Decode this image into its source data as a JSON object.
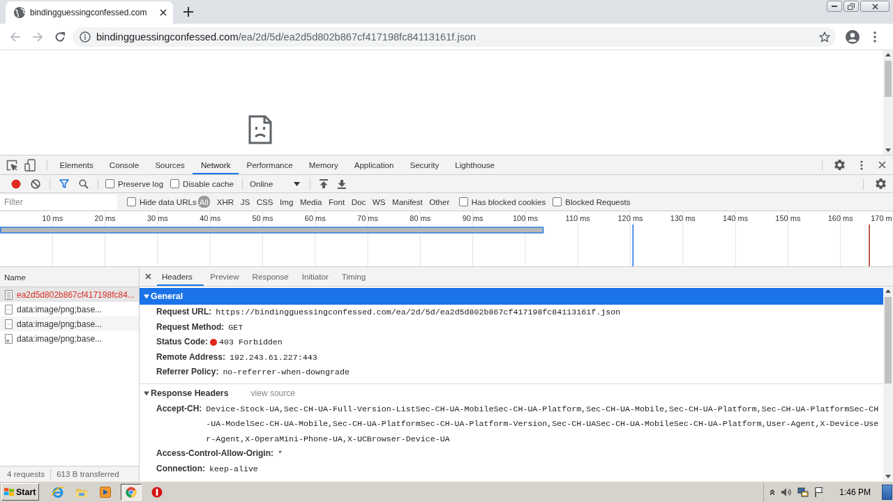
{
  "browser": {
    "tab": {
      "title": "bindingguessingconfessed.com"
    },
    "nav": [
      {
        "kind": "back",
        "disabled": true
      },
      {
        "kind": "forward",
        "disabled": true
      },
      {
        "kind": "reload",
        "disabled": false
      }
    ],
    "address": {
      "domain": "bindingguessingconfessed.com",
      "path": "/ea/2d/5d/ea2d5d802b867cf417198fc84113161f.json"
    }
  },
  "devtools": {
    "panels": [
      {
        "label": "Elements",
        "selected": false
      },
      {
        "label": "Console",
        "selected": false
      },
      {
        "label": "Sources",
        "selected": false
      },
      {
        "label": "Network",
        "selected": true
      },
      {
        "label": "Performance",
        "selected": false
      },
      {
        "label": "Memory",
        "selected": false
      },
      {
        "label": "Application",
        "selected": false
      },
      {
        "label": "Security",
        "selected": false
      },
      {
        "label": "Lighthouse",
        "selected": false
      }
    ],
    "toolbar": {
      "recording": true,
      "filter_active": true,
      "options": [
        {
          "label": "Preserve log",
          "checked": false
        },
        {
          "label": "Disable cache",
          "checked": false
        }
      ],
      "throttling": "Online"
    },
    "filter": {
      "placeholder": "Filter",
      "hide_data_urls": {
        "label": "Hide data URLs",
        "checked": false
      },
      "types": [
        {
          "label": "All",
          "selected": true
        },
        {
          "label": "XHR",
          "selected": false
        },
        {
          "label": "JS",
          "selected": false
        },
        {
          "label": "CSS",
          "selected": false
        },
        {
          "label": "Img",
          "selected": false
        },
        {
          "label": "Media",
          "selected": false
        },
        {
          "label": "Font",
          "selected": false
        },
        {
          "label": "Doc",
          "selected": false
        },
        {
          "label": "WS",
          "selected": false
        },
        {
          "label": "Manifest",
          "selected": false
        },
        {
          "label": "Other",
          "selected": false
        }
      ],
      "options": [
        {
          "label": "Has blocked cookies",
          "checked": false
        },
        {
          "label": "Blocked Requests",
          "checked": false
        }
      ]
    },
    "overview": {
      "chart_data": {
        "type": "bar",
        "orientation": "horizontal",
        "values": [
          103.5
        ],
        "xlim": [
          0,
          170
        ],
        "grid": true,
        "xticks": [
          {
            "value": 10,
            "label": "10 ms"
          },
          {
            "value": 20,
            "label": "20 ms"
          },
          {
            "value": 30,
            "label": "30 ms"
          },
          {
            "value": 40,
            "label": "40 ms"
          },
          {
            "value": 50,
            "label": "50 ms"
          },
          {
            "value": 60,
            "label": "60 ms"
          },
          {
            "value": 70,
            "label": "70 ms"
          },
          {
            "value": 80,
            "label": "80 ms"
          },
          {
            "value": 90,
            "label": "90 ms"
          },
          {
            "value": 100,
            "label": "100 ms"
          },
          {
            "value": 110,
            "label": "110 ms"
          },
          {
            "value": 120,
            "label": "120 ms"
          },
          {
            "value": 130,
            "label": "130 ms"
          },
          {
            "value": 140,
            "label": "140 ms"
          },
          {
            "value": 150,
            "label": "150 ms"
          },
          {
            "value": 160,
            "label": "160 ms"
          },
          {
            "value": 170,
            "label": "170 m"
          }
        ],
        "ref_lines": [
          {
            "axis": "x",
            "value": 120.5,
            "color": "#1a73e8"
          },
          {
            "axis": "x",
            "value": 165.5,
            "color": "#a52714"
          }
        ]
      }
    },
    "requests": {
      "column": "Name",
      "rows": [
        {
          "name": "ea2d5d802b867cf417198fc84...",
          "kind": "document",
          "error": true,
          "selected": true
        },
        {
          "name": "data:image/png;base...",
          "kind": "blank",
          "error": false,
          "selected": false
        },
        {
          "name": "data:image/png;base...",
          "kind": "blank",
          "error": false,
          "selected": false
        },
        {
          "name": "data:image/png;base...",
          "kind": "image",
          "error": false,
          "selected": false
        }
      ],
      "summary": [
        "4 requests",
        "613 B transferred"
      ]
    },
    "details": {
      "tabs": [
        {
          "label": "Headers",
          "selected": true
        },
        {
          "label": "Preview",
          "selected": false
        },
        {
          "label": "Response",
          "selected": false
        },
        {
          "label": "Initiator",
          "selected": false
        },
        {
          "label": "Timing",
          "selected": false
        }
      ],
      "sections": [
        {
          "title": "General",
          "expanded": true,
          "selected": true,
          "rows": [
            {
              "kind": "plain",
              "label": "Request URL:",
              "value": "https://bindingguessingconfessed.com/ea/2d/5d/ea2d5d802b867cf417198fc84113161f.json"
            },
            {
              "kind": "plain",
              "label": "Request Method:",
              "value": "GET"
            },
            {
              "kind": "status",
              "label": "Status Code:",
              "value": "403 Forbidden"
            },
            {
              "kind": "plain",
              "label": "Remote Address:",
              "value": "192.243.61.227:443"
            },
            {
              "kind": "plain",
              "label": "Referrer Policy:",
              "value": "no-referrer-when-downgrade"
            }
          ]
        },
        {
          "title": "Response Headers",
          "expanded": true,
          "selected": false,
          "link": "view source",
          "rows": [
            {
              "kind": "plain",
              "label": "Accept-CH:",
              "value": "Device-Stock-UA,Sec-CH-UA-Full-Version-ListSec-CH-UA-MobileSec-CH-UA-Platform,Sec-CH-UA-Mobile,Sec-CH-UA-Platform,Sec-CH-UA-PlatformSec-CH-UA-ModelSec-CH-UA-Mobile,Sec-CH-UA-PlatformSec-CH-UA-Platform-Version,Sec-CH-UASec-CH-UA-MobileSec-CH-UA-Platform,User-Agent,X-Device-User-Agent,X-OperaMini-Phone-UA,X-UCBrowser-Device-UA"
            },
            {
              "kind": "plain",
              "label": "Access-Control-Allow-Origin:",
              "value": "*"
            },
            {
              "kind": "plain",
              "label": "Connection:",
              "value": "keep-alive"
            }
          ]
        }
      ]
    }
  },
  "taskbar": {
    "start": "Start",
    "apps": [
      {
        "kind": "e-globe",
        "active": false
      },
      {
        "kind": "folder",
        "active": false
      },
      {
        "kind": "player",
        "active": false
      },
      {
        "kind": "wheel",
        "active": true
      },
      {
        "kind": "stop",
        "active": false
      }
    ],
    "clock": "1:46 PM"
  }
}
